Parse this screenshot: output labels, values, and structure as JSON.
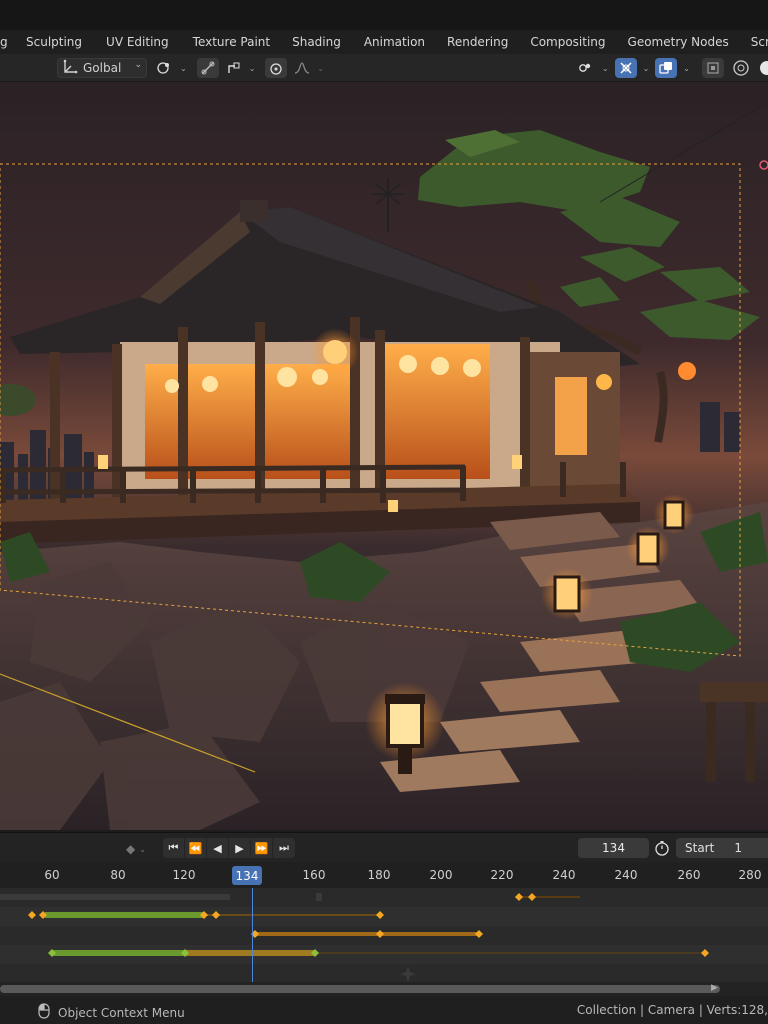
{
  "workspace_tabs": [
    "Sculpting",
    "UV Editing",
    "Texture Paint",
    "Shading",
    "Animation",
    "Rendering",
    "Compositing",
    "Geometry Nodes",
    "Scripting"
  ],
  "tab_plus": "+",
  "viewport_header": {
    "pivot_label": "Golbal",
    "icons": [
      "transform-pivot-icon",
      "snap-icon",
      "snap-to-icon",
      "proportional-edit-icon",
      "falloff-icon",
      "visibility-icon",
      "gizmo-icon",
      "overlay-icon",
      "xray-icon",
      "shading-icon"
    ]
  },
  "timeline": {
    "current_frame": "134",
    "start_label": "Start",
    "start_value": "1",
    "ruler_ticks": [
      "60",
      "80",
      "120",
      "134",
      "160",
      "180",
      "200",
      "220",
      "240",
      "240",
      "260",
      "280"
    ],
    "playback_controls": [
      "jump-to-start",
      "jump-to-keyframe-prev",
      "play-reverse",
      "play",
      "jump-to-keyframe-next",
      "jump-to-end"
    ]
  },
  "status_bar": {
    "left_text": "Object Context Menu",
    "right_text": "Collection | Camera | Verts:128,"
  },
  "colors": {
    "accent": "#4772b3",
    "keyframe": "#f5a623",
    "green_bar": "#6a9a2e"
  }
}
